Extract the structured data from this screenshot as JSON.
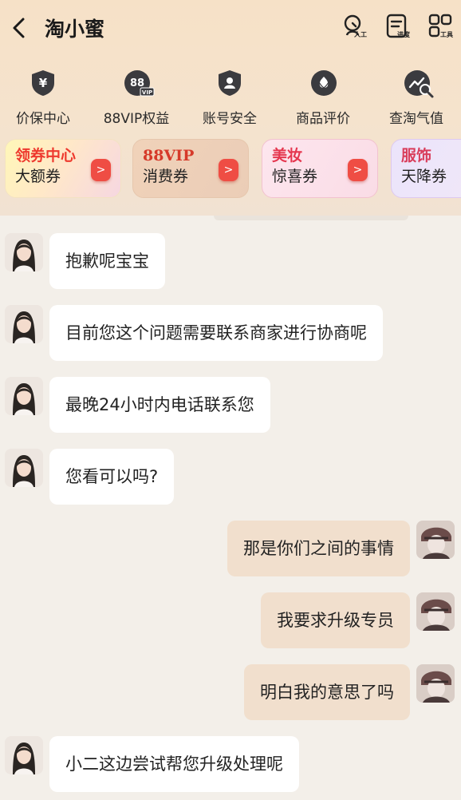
{
  "header": {
    "title": "淘小蜜",
    "actions": [
      {
        "label": "人工",
        "icon": "agent-headset-icon"
      },
      {
        "label": "进度",
        "icon": "progress-document-icon"
      },
      {
        "label": "工具",
        "icon": "tools-grid-icon"
      }
    ]
  },
  "services": [
    {
      "label": "价保中心",
      "icon": "price-protect-yen-icon"
    },
    {
      "label": "88VIP权益",
      "icon": "vip-88-icon"
    },
    {
      "label": "账号安全",
      "icon": "account-security-shield-icon"
    },
    {
      "label": "商品评价",
      "icon": "product-review-icon"
    },
    {
      "label": "查淘气值",
      "icon": "taoqi-value-search-icon"
    }
  ],
  "coupons": [
    {
      "title": "领券中心",
      "subtitle": "大额券",
      "go": ">"
    },
    {
      "title": "88VIP",
      "subtitle": "消费券",
      "go": ">"
    },
    {
      "title": "美妆",
      "subtitle": "惊喜券",
      "go": ">"
    },
    {
      "title": "服饰",
      "subtitle": "天降券",
      "go": ">"
    }
  ],
  "messages": [
    {
      "from": "agent",
      "text": "抱歉呢宝宝"
    },
    {
      "from": "agent",
      "text": "目前您这个问题需要联系商家进行协商呢"
    },
    {
      "from": "agent",
      "text": "最晚24小时内电话联系您"
    },
    {
      "from": "agent",
      "text": "您看可以吗?"
    },
    {
      "from": "user",
      "text": "那是你们之间的事情"
    },
    {
      "from": "user",
      "text": "我要求升级专员"
    },
    {
      "from": "user",
      "text": "明白我的意思了吗"
    },
    {
      "from": "agent",
      "text": "小二这边尝试帮您升级处理呢"
    }
  ],
  "colors": {
    "header_bg": "#f6e1c7",
    "chat_bg": "#f3efe9",
    "user_bubble": "#f1dfcd",
    "agent_bubble": "#ffffff",
    "accent_red": "#ef4d44"
  }
}
